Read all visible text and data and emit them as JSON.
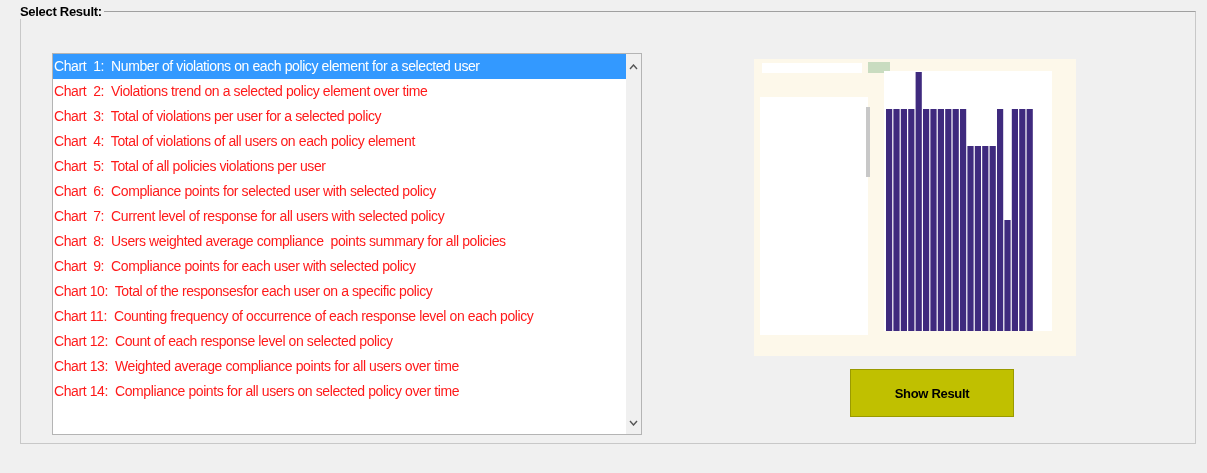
{
  "group": {
    "title": "Select Result:"
  },
  "charts": [
    {
      "label": "Chart  1:  Number of violations on each policy element for a selected user",
      "selected": true
    },
    {
      "label": "Chart  2:  Violations trend on a selected policy element over time",
      "selected": false
    },
    {
      "label": "Chart  3:  Total of violations per user for a selected policy",
      "selected": false
    },
    {
      "label": "Chart  4:  Total of violations of all users on each policy element",
      "selected": false
    },
    {
      "label": "Chart  5:  Total of all policies violations per user",
      "selected": false
    },
    {
      "label": "Chart  6:  Compliance points for selected user with selected policy",
      "selected": false
    },
    {
      "label": "Chart  7:  Current level of response for all users with selected policy",
      "selected": false
    },
    {
      "label": "Chart  8:  Users weighted average compliance  points summary for all policies",
      "selected": false
    },
    {
      "label": "Chart  9:  Compliance points for each user with selected policy",
      "selected": false
    },
    {
      "label": "Chart 10:  Total of the responsesfor each user on a specific policy",
      "selected": false
    },
    {
      "label": "Chart 11:  Counting frequency of occurrence of each response level on each policy",
      "selected": false
    },
    {
      "label": "Chart 12:  Count of each response level on selected policy",
      "selected": false
    },
    {
      "label": "Chart 13:  Weighted average compliance points for all users over time",
      "selected": false
    },
    {
      "label": "Chart 14:  Compliance points for all users on selected policy over time",
      "selected": false
    }
  ],
  "button": {
    "label": "Show Result"
  }
}
